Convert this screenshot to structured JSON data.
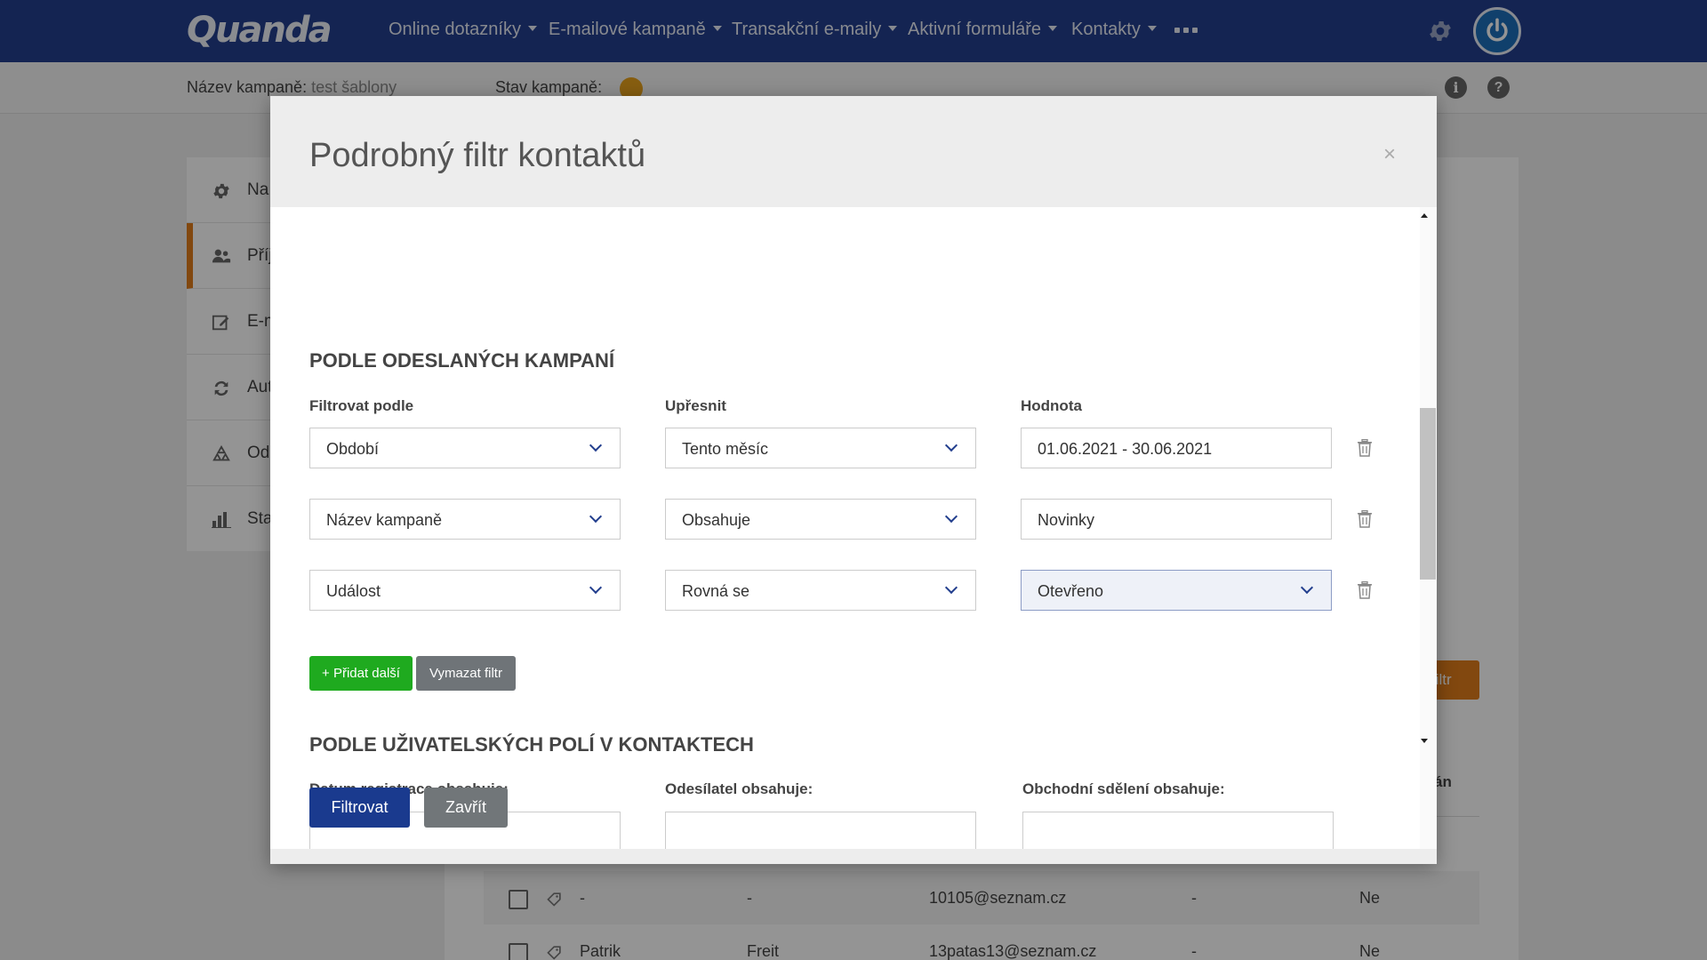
{
  "app": {
    "logo": "Quanda"
  },
  "nav": {
    "items": [
      "Online dotazníky",
      "E-mailové kampaně",
      "Transakční e-maily",
      "Aktivní formuláře",
      "Kontakty"
    ]
  },
  "subheader": {
    "campaign_label": "Název kampaně:",
    "campaign_name": "test šablony",
    "status_label": "Stav kampaně:"
  },
  "sidebar": {
    "items": [
      {
        "label": "Na",
        "icon": "gear-icon"
      },
      {
        "label": "Příj",
        "icon": "users-icon"
      },
      {
        "label": "E-m",
        "icon": "edit-icon"
      },
      {
        "label": "Aut",
        "icon": "refresh-icon"
      },
      {
        "label": "Od",
        "icon": "recycle-icon"
      },
      {
        "label": "Sta",
        "icon": "bar-chart-icon"
      }
    ]
  },
  "background": {
    "filter_button": "filtr",
    "column_partial": "án",
    "rows": [
      {
        "name": "-",
        "surname": "-",
        "email": "10105@seznam.cz",
        "col4": "-",
        "col5": "Ne"
      },
      {
        "name": "Patrik",
        "surname": "Freit",
        "email": "13patas13@seznam.cz",
        "col4": "-",
        "col5": "Ne"
      }
    ]
  },
  "modal": {
    "title": "Podrobný filtr kontaktů",
    "close": "×",
    "section1": {
      "title": "PODLE ODESLANÝCH KAMPANÍ",
      "col_filter": "Filtrovat podle",
      "col_refine": "Upřesnit",
      "col_value": "Hodnota",
      "rows": [
        {
          "filter": "Období",
          "refine": "Tento měsíc",
          "value": "01.06.2021 - 30.06.2021"
        },
        {
          "filter": "Název kampaně",
          "refine": "Obsahuje",
          "value": "Novinky"
        },
        {
          "filter": "Událost",
          "refine": "Rovná se",
          "value": "Otevřeno"
        }
      ],
      "add_button": "+ Přidat další",
      "clear_button": "Vymazat filtr"
    },
    "section2": {
      "title": "PODLE UŽIVATELSKÝCH POLÍ V KONTAKTECH",
      "field1": "Datum registrace obsahuje:",
      "field2": "Odesílatel obsahuje:",
      "field3": "Obchodní sdělení obsahuje:"
    },
    "footer": {
      "filter_button": "Filtrovat",
      "close_button": "Zavřít"
    }
  },
  "colors": {
    "nav_bg": "#233f8e",
    "accent_orange": "#e07d1a",
    "add_green": "#1faa1f",
    "primary_blue": "#1a3a8e"
  }
}
